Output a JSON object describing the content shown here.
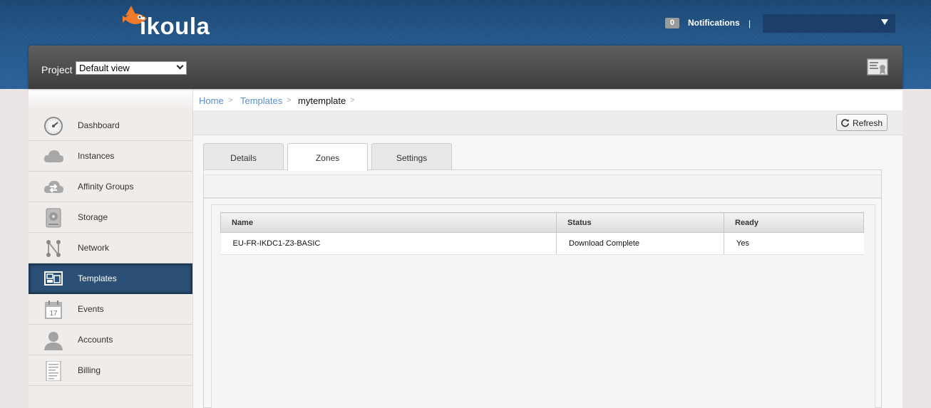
{
  "header": {
    "brand": "ikoula",
    "notifications_count": "0",
    "notifications_label": "Notifications",
    "separator": "|",
    "user_name": ""
  },
  "project": {
    "label": "Project",
    "selected": "Default view"
  },
  "sidebar": {
    "items": [
      {
        "label": "Dashboard",
        "icon": "dashboard-gauge-icon"
      },
      {
        "label": "Instances",
        "icon": "cloud-icon"
      },
      {
        "label": "Affinity Groups",
        "icon": "cloud-arrows-icon"
      },
      {
        "label": "Storage",
        "icon": "disk-icon"
      },
      {
        "label": "Network",
        "icon": "network-icon"
      },
      {
        "label": "Templates",
        "icon": "templates-icon",
        "active": true
      },
      {
        "label": "Events",
        "icon": "calendar-icon",
        "badge": "17"
      },
      {
        "label": "Accounts",
        "icon": "user-icon"
      },
      {
        "label": "Billing",
        "icon": "document-icon"
      }
    ]
  },
  "breadcrumb": {
    "home": "Home",
    "templates": "Templates",
    "current": "mytemplate",
    "sep": ">"
  },
  "toolbar": {
    "refresh_label": "Refresh"
  },
  "tabs": [
    {
      "label": "Details"
    },
    {
      "label": "Zones",
      "active": true
    },
    {
      "label": "Settings"
    }
  ],
  "zones_table": {
    "headers": [
      "Name",
      "Status",
      "Ready"
    ],
    "rows": [
      [
        "EU-FR-IKDC1-Z3-BASIC",
        "Download Complete",
        "Yes"
      ]
    ]
  },
  "colors": {
    "header": "#23578a",
    "active_nav": "#2c5075",
    "link": "#5d8fc5",
    "logo_orange": "#f07c2b"
  }
}
